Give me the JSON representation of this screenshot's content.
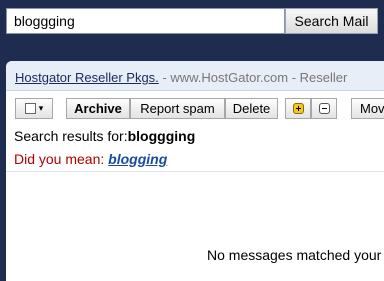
{
  "search": {
    "value": "bloggging",
    "button_label": "Search Mail"
  },
  "ad": {
    "title": "Hostgator Reseller Pkgs.",
    "separator": " - ",
    "domain": "www.HostGator.com - Reseller"
  },
  "toolbar": {
    "select_caret": "▾",
    "archive_label": "Archive",
    "spam_label": "Report spam",
    "delete_label": "Delete",
    "move_label": "Mov"
  },
  "results": {
    "prefix": "Search results for:",
    "query": "bloggging"
  },
  "suggestion": {
    "prefix": "Did you mean: ",
    "word": "blogging"
  },
  "empty_message": "No messages matched your",
  "colors": {
    "header_bg": "#1e2c4f",
    "did_you_mean": "#b00000",
    "link": "#1a4aa0"
  }
}
